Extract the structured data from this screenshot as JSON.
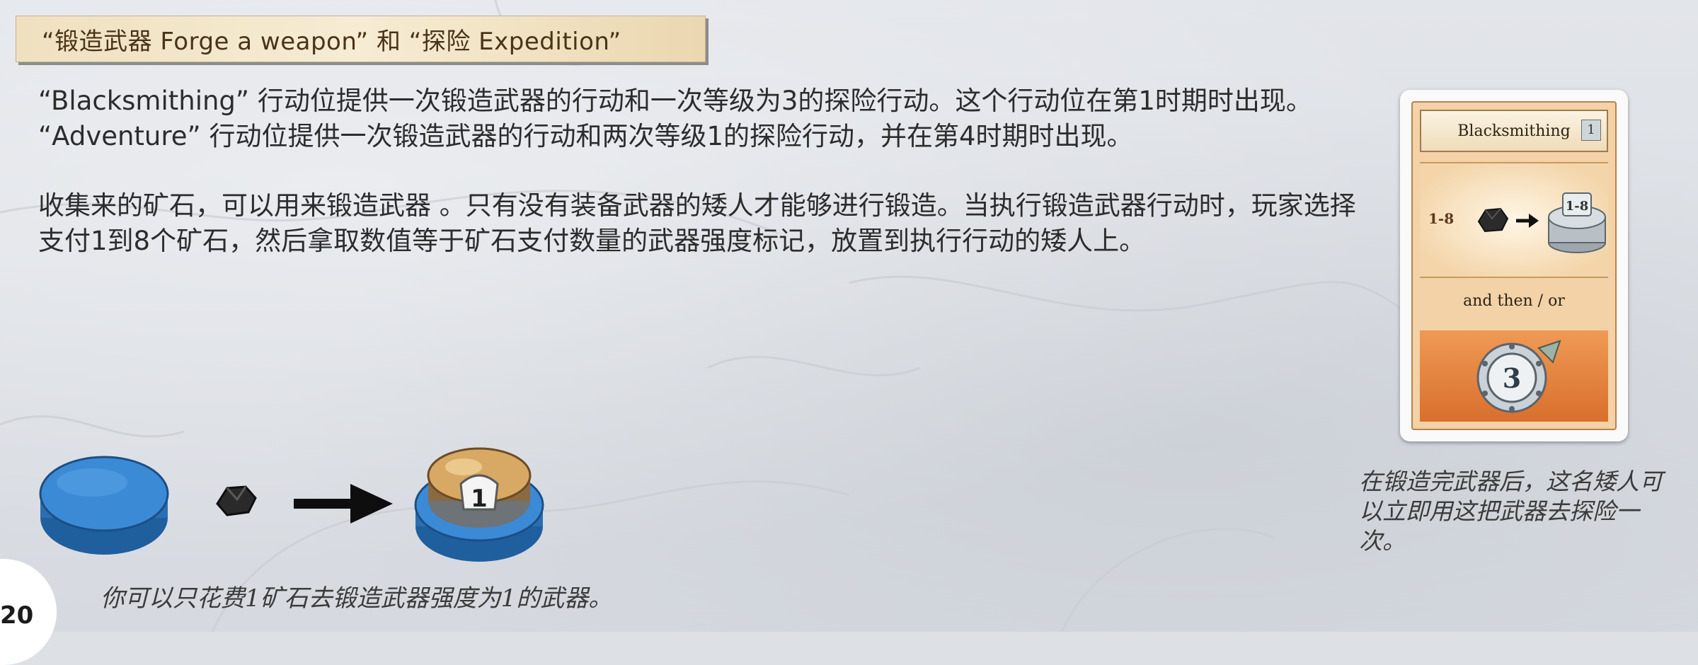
{
  "section_title": "“锻造武器 Forge a weapon” 和 “探险 Expedition”",
  "paragraph_1": "“Blacksmithing” 行动位提供一次锻造武器的行动和一次等级为3的探险行动。这个行动位在第1时期时出现。 “Adventure” 行动位提供一次锻造武器的行动和两次等级1的探险行动，并在第4时期时出现。",
  "paragraph_2": "收集来的矿石，可以用来锻造武器 。只有没有装备武器的矮人才能够进行锻造。当执行锻造武器行动时，玩家选择支付1到8个矿石，然后拿取数值等于矿石支付数量的武器强度标记，放置到执行行动的矮人上。",
  "card": {
    "title": "Blacksmithing",
    "level": "1",
    "forge_range": "1-8",
    "token_label": "1-8",
    "connector": "and then / or",
    "expedition_level": "3"
  },
  "card_caption": "在锻造完武器后，这名矮人可以立即用这把武器去探险一次。",
  "illustration": {
    "weapon_value": "1"
  },
  "bottom_caption": "你可以只花费1矿石去锻造武器强度为1的武器。",
  "page_number": "20",
  "colors": {
    "dwarf_blue": "#2f7fc8",
    "title_bar": "#f3e6c9",
    "card_orange": "#e58340"
  }
}
